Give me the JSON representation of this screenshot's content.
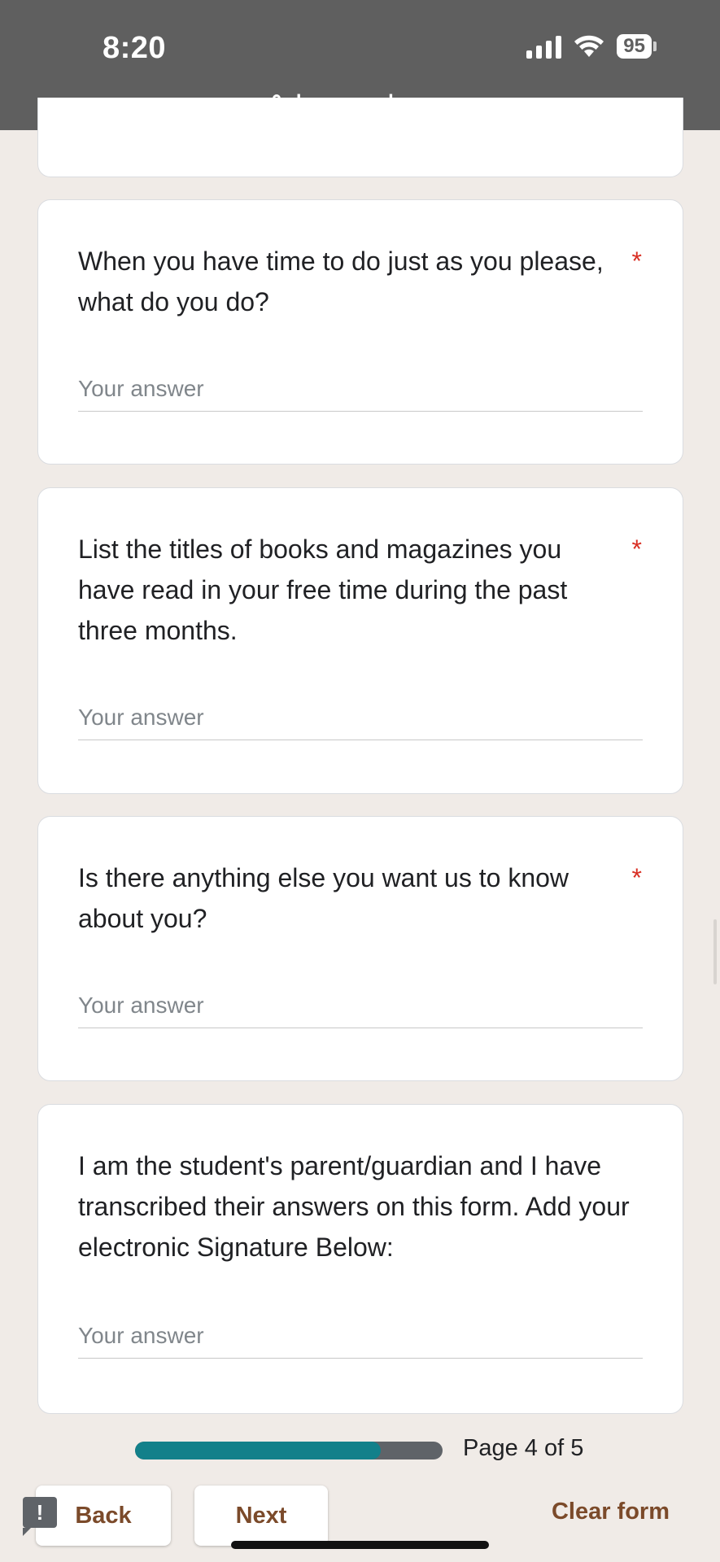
{
  "status_bar": {
    "time": "8:20",
    "battery": "95",
    "url": "docs.google.com"
  },
  "questions": [
    {
      "text": "When you have time to do just as you please, what do you do?",
      "required": "*",
      "placeholder": "Your answer"
    },
    {
      "text": "List the titles of books and magazines you have read in your free time during the past three months.",
      "required": "*",
      "placeholder": "Your answer"
    },
    {
      "text": "Is there anything else you want us to know about you?",
      "required": "*",
      "placeholder": "Your answer"
    },
    {
      "text": "I am the student's parent/guardian and I have transcribed their answers on this form.  Add your electronic Signature Below:",
      "required": "",
      "placeholder": "Your answer"
    }
  ],
  "progress": {
    "fraction": 0.8,
    "label": "Page 4 of 5"
  },
  "nav": {
    "back_label": "Back",
    "next_label": "Next",
    "clear_label": "Clear form"
  },
  "colors": {
    "accent": "#7b4a2a",
    "progress_fill": "#12808a",
    "required": "#d93025",
    "background": "#f0ebe7"
  },
  "icons": {
    "lock": "lock-icon",
    "feedback": "report-feedback-icon"
  }
}
